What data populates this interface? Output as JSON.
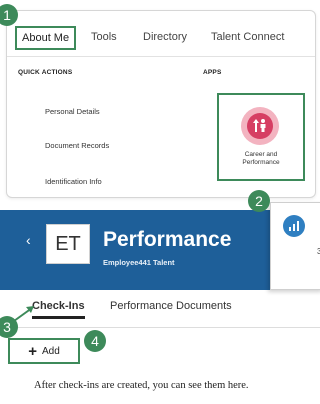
{
  "top_nav": {
    "tabs": [
      "About Me",
      "Tools",
      "Directory",
      "Talent Connect"
    ],
    "active": "About Me"
  },
  "quick_actions": {
    "heading": "QUICK ACTIONS",
    "items": [
      "Personal Details",
      "Document Records",
      "Identification Info"
    ]
  },
  "apps": {
    "heading": "APPS",
    "tile_label_line1": "Career and",
    "tile_label_line2": "Performance",
    "icon": "career-performance-icon",
    "icon_bg": "#d63e63"
  },
  "performance": {
    "back_icon": "chevron-left-icon",
    "avatar_initials": "ET",
    "title": "Performance",
    "subtitle": "Employee441 Talent",
    "header_color": "#1e5f99",
    "tabs": [
      "Check-Ins",
      "Performance Documents"
    ],
    "active_tab": "Check-Ins",
    "add_label": "Add",
    "empty_message": "After check-ins are created, you can see them here."
  },
  "callout": {
    "icon": "analytics-icon",
    "text": "3"
  },
  "steps": [
    "1",
    "2",
    "3",
    "4"
  ],
  "accent_color": "#3d8a5a"
}
